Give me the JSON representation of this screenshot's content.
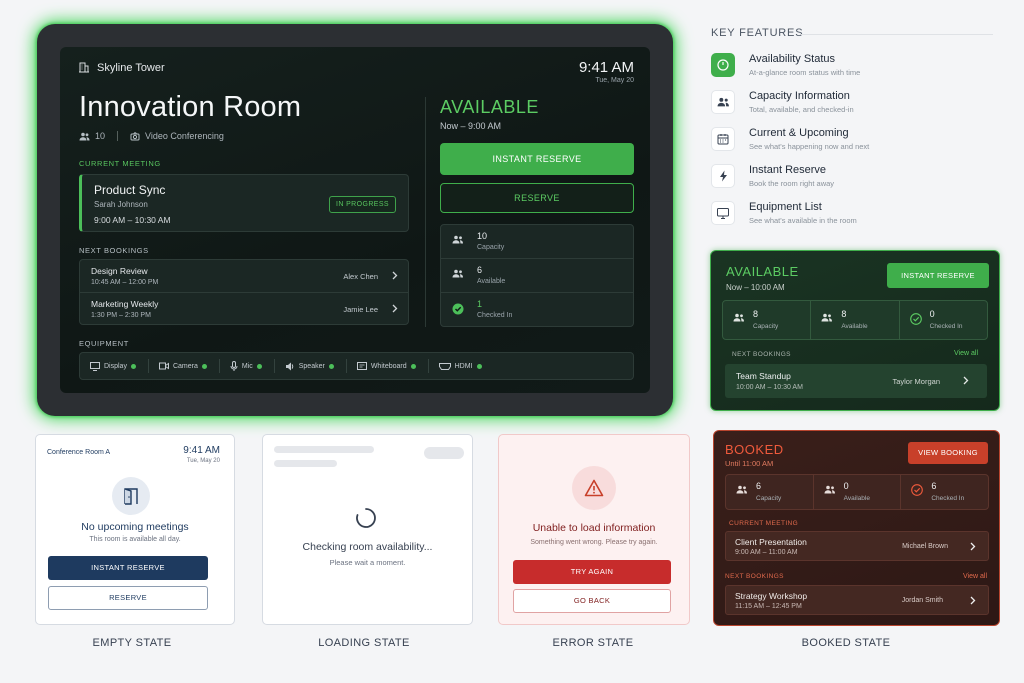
{
  "main_panel": {
    "building": "Skyline Tower",
    "time": "9:41 AM",
    "date": "Tue, May 20",
    "room_name": "Innovation Room",
    "capacity": "10",
    "feature": "Video Conferencing",
    "current_meeting_label": "CURRENT MEETING",
    "current_meeting": {
      "title": "Product Sync",
      "host": "Sarah Johnson",
      "time": "9:00 AM – 10:30 AM",
      "badge": "IN PROGRESS"
    },
    "next_bookings_label": "NEXT BOOKINGS",
    "next_bookings": [
      {
        "title": "Design Review",
        "time": "10:45 AM – 12:00 PM",
        "host": "Alex Chen"
      },
      {
        "title": "Marketing Weekly",
        "time": "1:30 PM – 2:30 PM",
        "host": "Jamie Lee"
      }
    ],
    "equipment_label": "EQUIPMENT",
    "equipment": [
      "Display",
      "Camera",
      "Mic",
      "Speaker",
      "Whiteboard",
      "HDMI"
    ],
    "status": "AVAILABLE",
    "status_sub": "Now – 9:00 AM",
    "instant_reserve": "INSTANT RESERVE",
    "reserve": "RESERVE",
    "stats": [
      {
        "value": "10",
        "label": "Capacity"
      },
      {
        "value": "6",
        "label": "Available"
      },
      {
        "value": "1",
        "label": "Checked In"
      }
    ]
  },
  "key_features": {
    "heading": "KEY FEATURES",
    "items": [
      {
        "title": "Availability Status",
        "desc": "At-a-glance room status with time",
        "icon": "clock-icon"
      },
      {
        "title": "Capacity Information",
        "desc": "Total, available, and checked-in",
        "icon": "people-icon"
      },
      {
        "title": "Current & Upcoming",
        "desc": "See what's happening now and next",
        "icon": "calendar-icon"
      },
      {
        "title": "Instant Reserve",
        "desc": "Book the room right away",
        "icon": "lightning-icon"
      },
      {
        "title": "Equipment List",
        "desc": "See what's available in the room",
        "icon": "monitor-icon"
      }
    ]
  },
  "available_widget": {
    "status": "AVAILABLE",
    "sub": "Now – 10:00 AM",
    "button": "INSTANT RESERVE",
    "stats": [
      {
        "value": "8",
        "label": "Capacity"
      },
      {
        "value": "8",
        "label": "Available"
      },
      {
        "value": "0",
        "label": "Checked In"
      }
    ],
    "next_label": "NEXT BOOKINGS",
    "view_all": "View all",
    "booking": {
      "title": "Team Standup",
      "time": "10:00 AM – 10:30 AM",
      "host": "Taylor Morgan"
    }
  },
  "booked_widget": {
    "status": "BOOKED",
    "sub": "Until 11:00 AM",
    "button": "VIEW BOOKING",
    "stats": [
      {
        "value": "6",
        "label": "Capacity"
      },
      {
        "value": "0",
        "label": "Available"
      },
      {
        "value": "6",
        "label": "Checked In"
      }
    ],
    "current_label": "CURRENT MEETING",
    "current": {
      "title": "Client Presentation",
      "time": "9:00 AM – 11:00 AM",
      "host": "Michael Brown"
    },
    "next_label": "NEXT BOOKINGS",
    "view_all": "View all",
    "next": {
      "title": "Strategy Workshop",
      "time": "11:15 AM – 12:45 PM",
      "host": "Jordan Smith"
    },
    "caption": "BOOKED STATE"
  },
  "empty_state": {
    "room": "Conference Room A",
    "time": "9:41 AM",
    "date": "Tue, May 20",
    "title": "No upcoming meetings",
    "desc": "This room is available all day.",
    "primary": "INSTANT RESERVE",
    "secondary": "RESERVE",
    "caption": "EMPTY STATE"
  },
  "loading_state": {
    "title": "Checking room availability...",
    "desc": "Please wait a moment.",
    "caption": "LOADING STATE"
  },
  "error_state": {
    "title": "Unable to load information",
    "desc": "Something went wrong. Please try again.",
    "primary": "TRY AGAIN",
    "secondary": "GO BACK",
    "caption": "ERROR STATE"
  },
  "colors": {
    "accent_green": "#3fae4b",
    "booked_red": "#c8402a",
    "navy": "#1e3a5f"
  }
}
